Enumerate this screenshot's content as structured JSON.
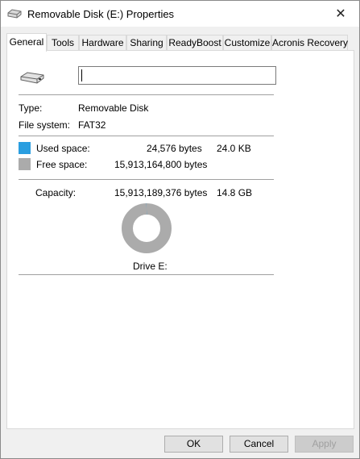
{
  "window": {
    "title": "Removable Disk (E:) Properties",
    "close_glyph": "✕"
  },
  "tabs": [
    {
      "label": "General",
      "active": true
    },
    {
      "label": "Tools"
    },
    {
      "label": "Hardware"
    },
    {
      "label": "Sharing"
    },
    {
      "label": "ReadyBoost"
    },
    {
      "label": "Customize"
    },
    {
      "label": "Acronis Recovery"
    }
  ],
  "general": {
    "name_value": "",
    "type_label": "Type:",
    "type_value": "Removable Disk",
    "fs_label": "File system:",
    "fs_value": "FAT32",
    "used_label": "Used space:",
    "used_bytes": "24,576 bytes",
    "used_size": "24.0 KB",
    "free_label": "Free space:",
    "free_bytes": "15,913,164,800 bytes",
    "capacity_label": "Capacity:",
    "capacity_bytes": "15,913,189,376 bytes",
    "capacity_size": "14.8 GB",
    "drive_label": "Drive E:",
    "used_fraction": 1.5e-06
  },
  "colors": {
    "used": "#2a9ee0",
    "free": "#ababab"
  },
  "buttons": {
    "ok": "OK",
    "cancel": "Cancel",
    "apply": "Apply"
  }
}
